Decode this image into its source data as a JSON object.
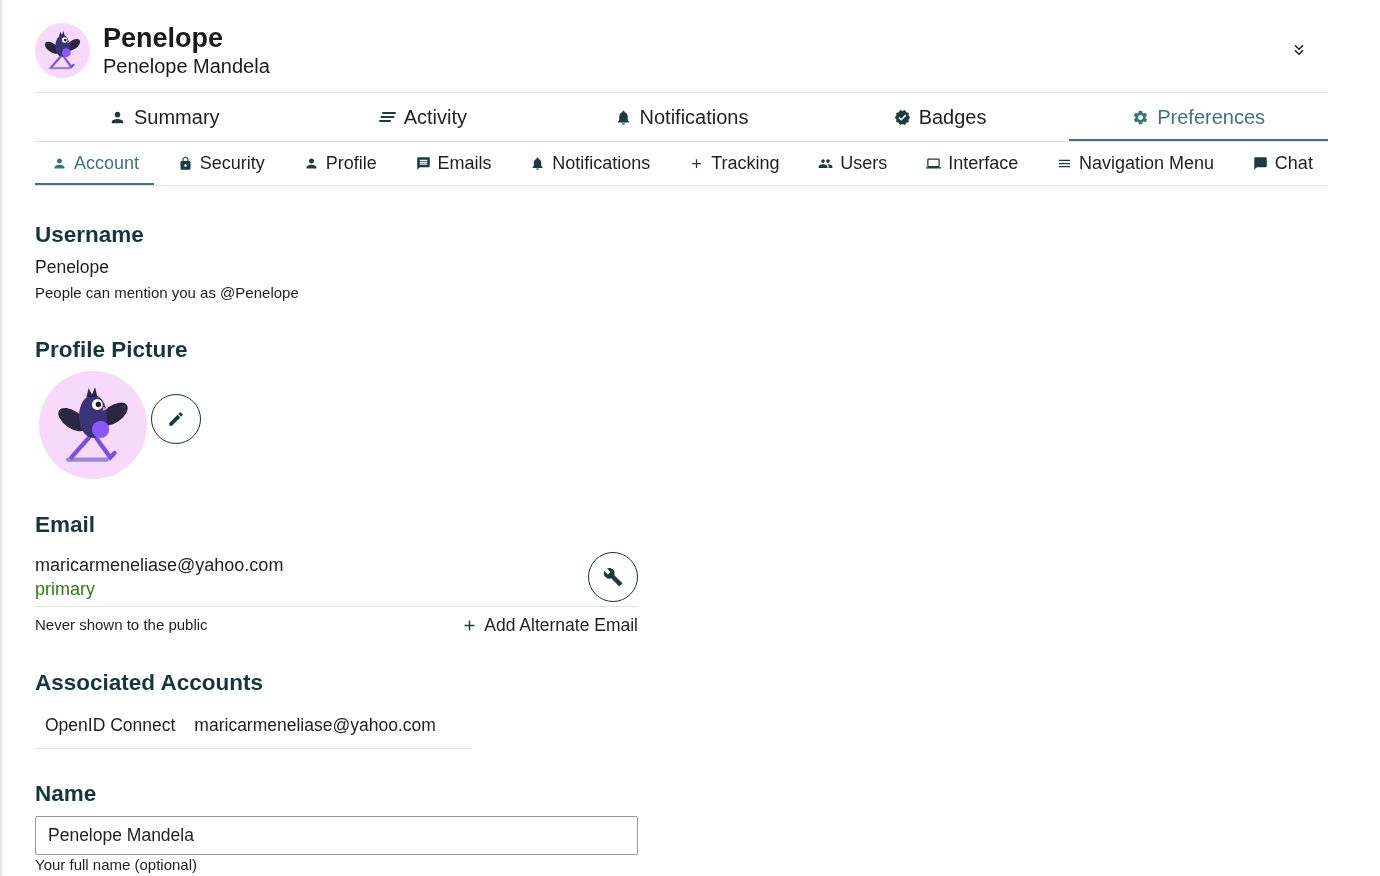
{
  "header": {
    "username": "Penelope",
    "full_name": "Penelope Mandela"
  },
  "main_tabs": [
    {
      "label": "Summary",
      "selected": false
    },
    {
      "label": "Activity",
      "selected": false
    },
    {
      "label": "Notifications",
      "selected": false
    },
    {
      "label": "Badges",
      "selected": false
    },
    {
      "label": "Preferences",
      "selected": true
    }
  ],
  "sub_tabs": [
    {
      "label": "Account",
      "selected": true
    },
    {
      "label": "Security",
      "selected": false
    },
    {
      "label": "Profile",
      "selected": false
    },
    {
      "label": "Emails",
      "selected": false
    },
    {
      "label": "Notifications",
      "selected": false
    },
    {
      "label": "Tracking",
      "selected": false
    },
    {
      "label": "Users",
      "selected": false
    },
    {
      "label": "Interface",
      "selected": false
    },
    {
      "label": "Navigation Menu",
      "selected": false
    },
    {
      "label": "Chat",
      "selected": false
    }
  ],
  "username": {
    "heading": "Username",
    "value": "Penelope",
    "hint": "People can mention you as @Penelope"
  },
  "profile_picture": {
    "heading": "Profile Picture"
  },
  "email": {
    "heading": "Email",
    "address": "maricarmeneliase@yahoo.com",
    "tag": "primary",
    "hint": "Never shown to the public",
    "add_label": "Add Alternate Email"
  },
  "associated_accounts": {
    "heading": "Associated Accounts",
    "rows": [
      {
        "provider": "OpenID Connect",
        "account": "maricarmeneliase@yahoo.com"
      }
    ]
  },
  "name": {
    "heading": "Name",
    "value": "Penelope Mandela",
    "hint": "Your full name (optional)"
  }
}
